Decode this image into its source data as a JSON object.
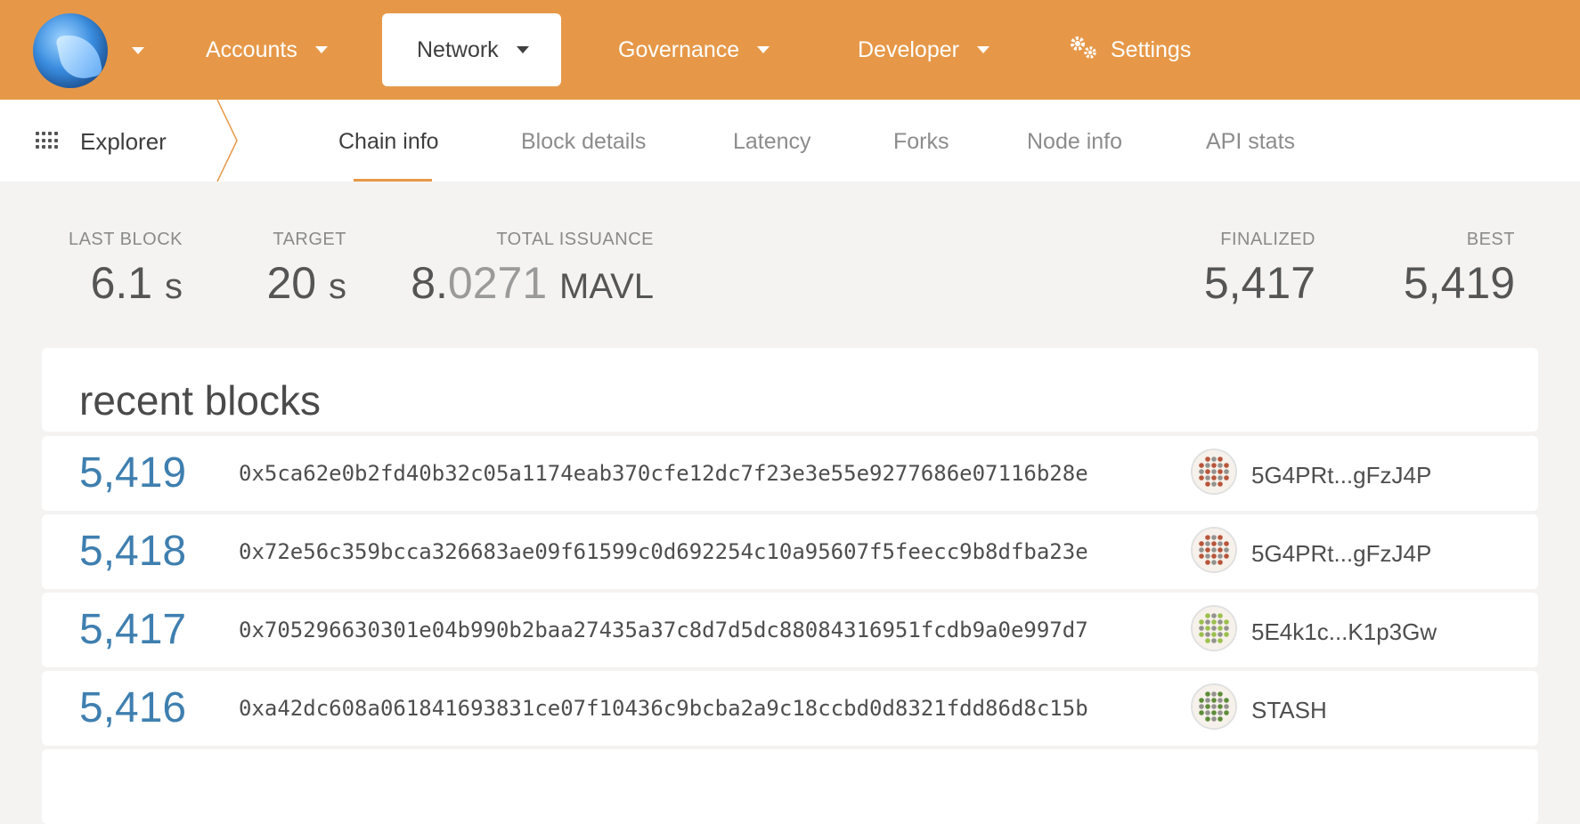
{
  "topnav": {
    "items": [
      {
        "label": "Accounts"
      },
      {
        "label": "Network"
      },
      {
        "label": "Governance"
      },
      {
        "label": "Developer"
      },
      {
        "label": "Settings"
      }
    ]
  },
  "subnav": {
    "section": "Explorer",
    "tabs": [
      {
        "label": "Chain info"
      },
      {
        "label": "Block details"
      },
      {
        "label": "Latency"
      },
      {
        "label": "Forks"
      },
      {
        "label": "Node info"
      },
      {
        "label": "API stats"
      }
    ]
  },
  "stats": {
    "last_block": {
      "label": "LAST BLOCK",
      "value": "6.1",
      "unit": "s"
    },
    "target": {
      "label": "TARGET",
      "value": "20",
      "unit": "s"
    },
    "total_issuance": {
      "label": "TOTAL ISSUANCE",
      "int": "8.",
      "frac": "0271",
      "unit": "MAVL"
    },
    "finalized": {
      "label": "FINALIZED",
      "value": "5,417"
    },
    "best": {
      "label": "BEST",
      "value": "5,419"
    }
  },
  "recent_blocks": {
    "title": "recent blocks",
    "rows": [
      {
        "number": "5,419",
        "hash": "0x5ca62e0b2fd40b32c05a1174eab370cfe12dc7f23e3e55e9277686e07116b28e",
        "author": "5G4PRt...gFzJ4P",
        "avatar_color": "#b8553a"
      },
      {
        "number": "5,418",
        "hash": "0x72e56c359bcca326683ae09f61599c0d692254c10a95607f5feecc9b8dfba23e",
        "author": "5G4PRt...gFzJ4P",
        "avatar_color": "#b8553a"
      },
      {
        "number": "5,417",
        "hash": "0x705296630301e04b990b2baa27435a37c8d7d5dc88084316951fcdb9a0e997d7",
        "author": "5E4k1c...K1p3Gw",
        "avatar_color": "#9bc04c"
      },
      {
        "number": "5,416",
        "hash": "0xa42dc608a061841693831ce07f10436c9bcba2a9c18ccbd0d8321fdd86d8c15b",
        "author": "STASH",
        "avatar_color": "#5e8d3a"
      }
    ]
  }
}
